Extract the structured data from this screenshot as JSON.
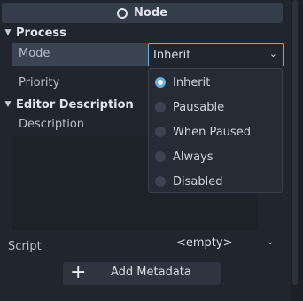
{
  "header": {
    "title": "Node",
    "icon": "node-circle-icon"
  },
  "sections": {
    "process": "Process",
    "editor_description": "Editor Description"
  },
  "properties": {
    "mode_label": "Mode",
    "mode_value": "Inherit",
    "priority_label": "Priority",
    "description_label": "Description",
    "script_label": "Script",
    "script_value": "<empty>"
  },
  "dropdown": {
    "options": [
      "Inherit",
      "Pausable",
      "When Paused",
      "Always",
      "Disabled"
    ],
    "selected": "Inherit"
  },
  "buttons": {
    "add_metadata": "Add Metadata"
  },
  "colors": {
    "accent": "#6aaedf",
    "background": "#21262e",
    "selected_row": "#3b4452"
  }
}
